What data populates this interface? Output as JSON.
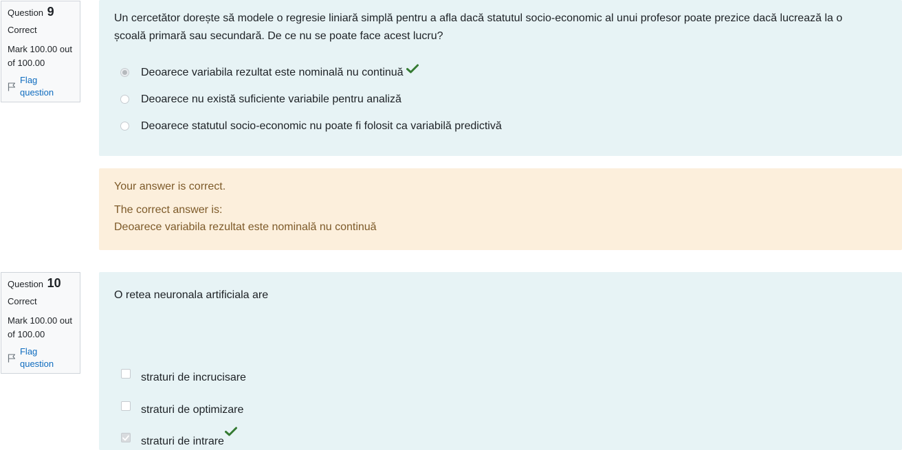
{
  "q9": {
    "info": {
      "question_label": "Question",
      "number": "9",
      "state": "Correct",
      "grade": "Mark 100.00 out of 100.00",
      "flag": "Flag question"
    },
    "text": "Un cercetător dorește să modele o regresie liniară simplă pentru a afla dacă statutul socio-economic al unui profesor poate prezice dacă lucrează la o școală primară sau secundară. De ce nu se poate face acest lucru?",
    "options": [
      {
        "label": "Deoarece variabila rezultat este nominală nu continuă",
        "selected": true,
        "correct": true
      },
      {
        "label": "Deoarece nu există suficiente variabile pentru analiză",
        "selected": false,
        "correct": false
      },
      {
        "label": "Deoarece statutul socio-economic nu poate fi folosit ca variabilă predictivă",
        "selected": false,
        "correct": false
      }
    ],
    "feedback": {
      "line1": "Your answer is correct.",
      "line2": "The correct answer is:",
      "line3": "Deoarece variabila rezultat este nominală nu continuă"
    }
  },
  "q10": {
    "info": {
      "question_label": "Question",
      "number": "10",
      "state": "Correct",
      "grade": "Mark 100.00 out of 100.00",
      "flag": "Flag question"
    },
    "text": "O retea neuronala artificiala are",
    "options": [
      {
        "label": "straturi de incrucisare",
        "selected": false,
        "correct": false
      },
      {
        "label": "straturi de optimizare",
        "selected": false,
        "correct": false
      },
      {
        "label": "straturi de intrare",
        "selected": true,
        "correct": true
      }
    ]
  },
  "colors": {
    "formulation_bg": "#e7f3f5",
    "feedback_bg": "#fcefdc",
    "feedback_text": "#7d5a29",
    "link": "#0f6cbf",
    "correct_tick": "#357a32"
  }
}
